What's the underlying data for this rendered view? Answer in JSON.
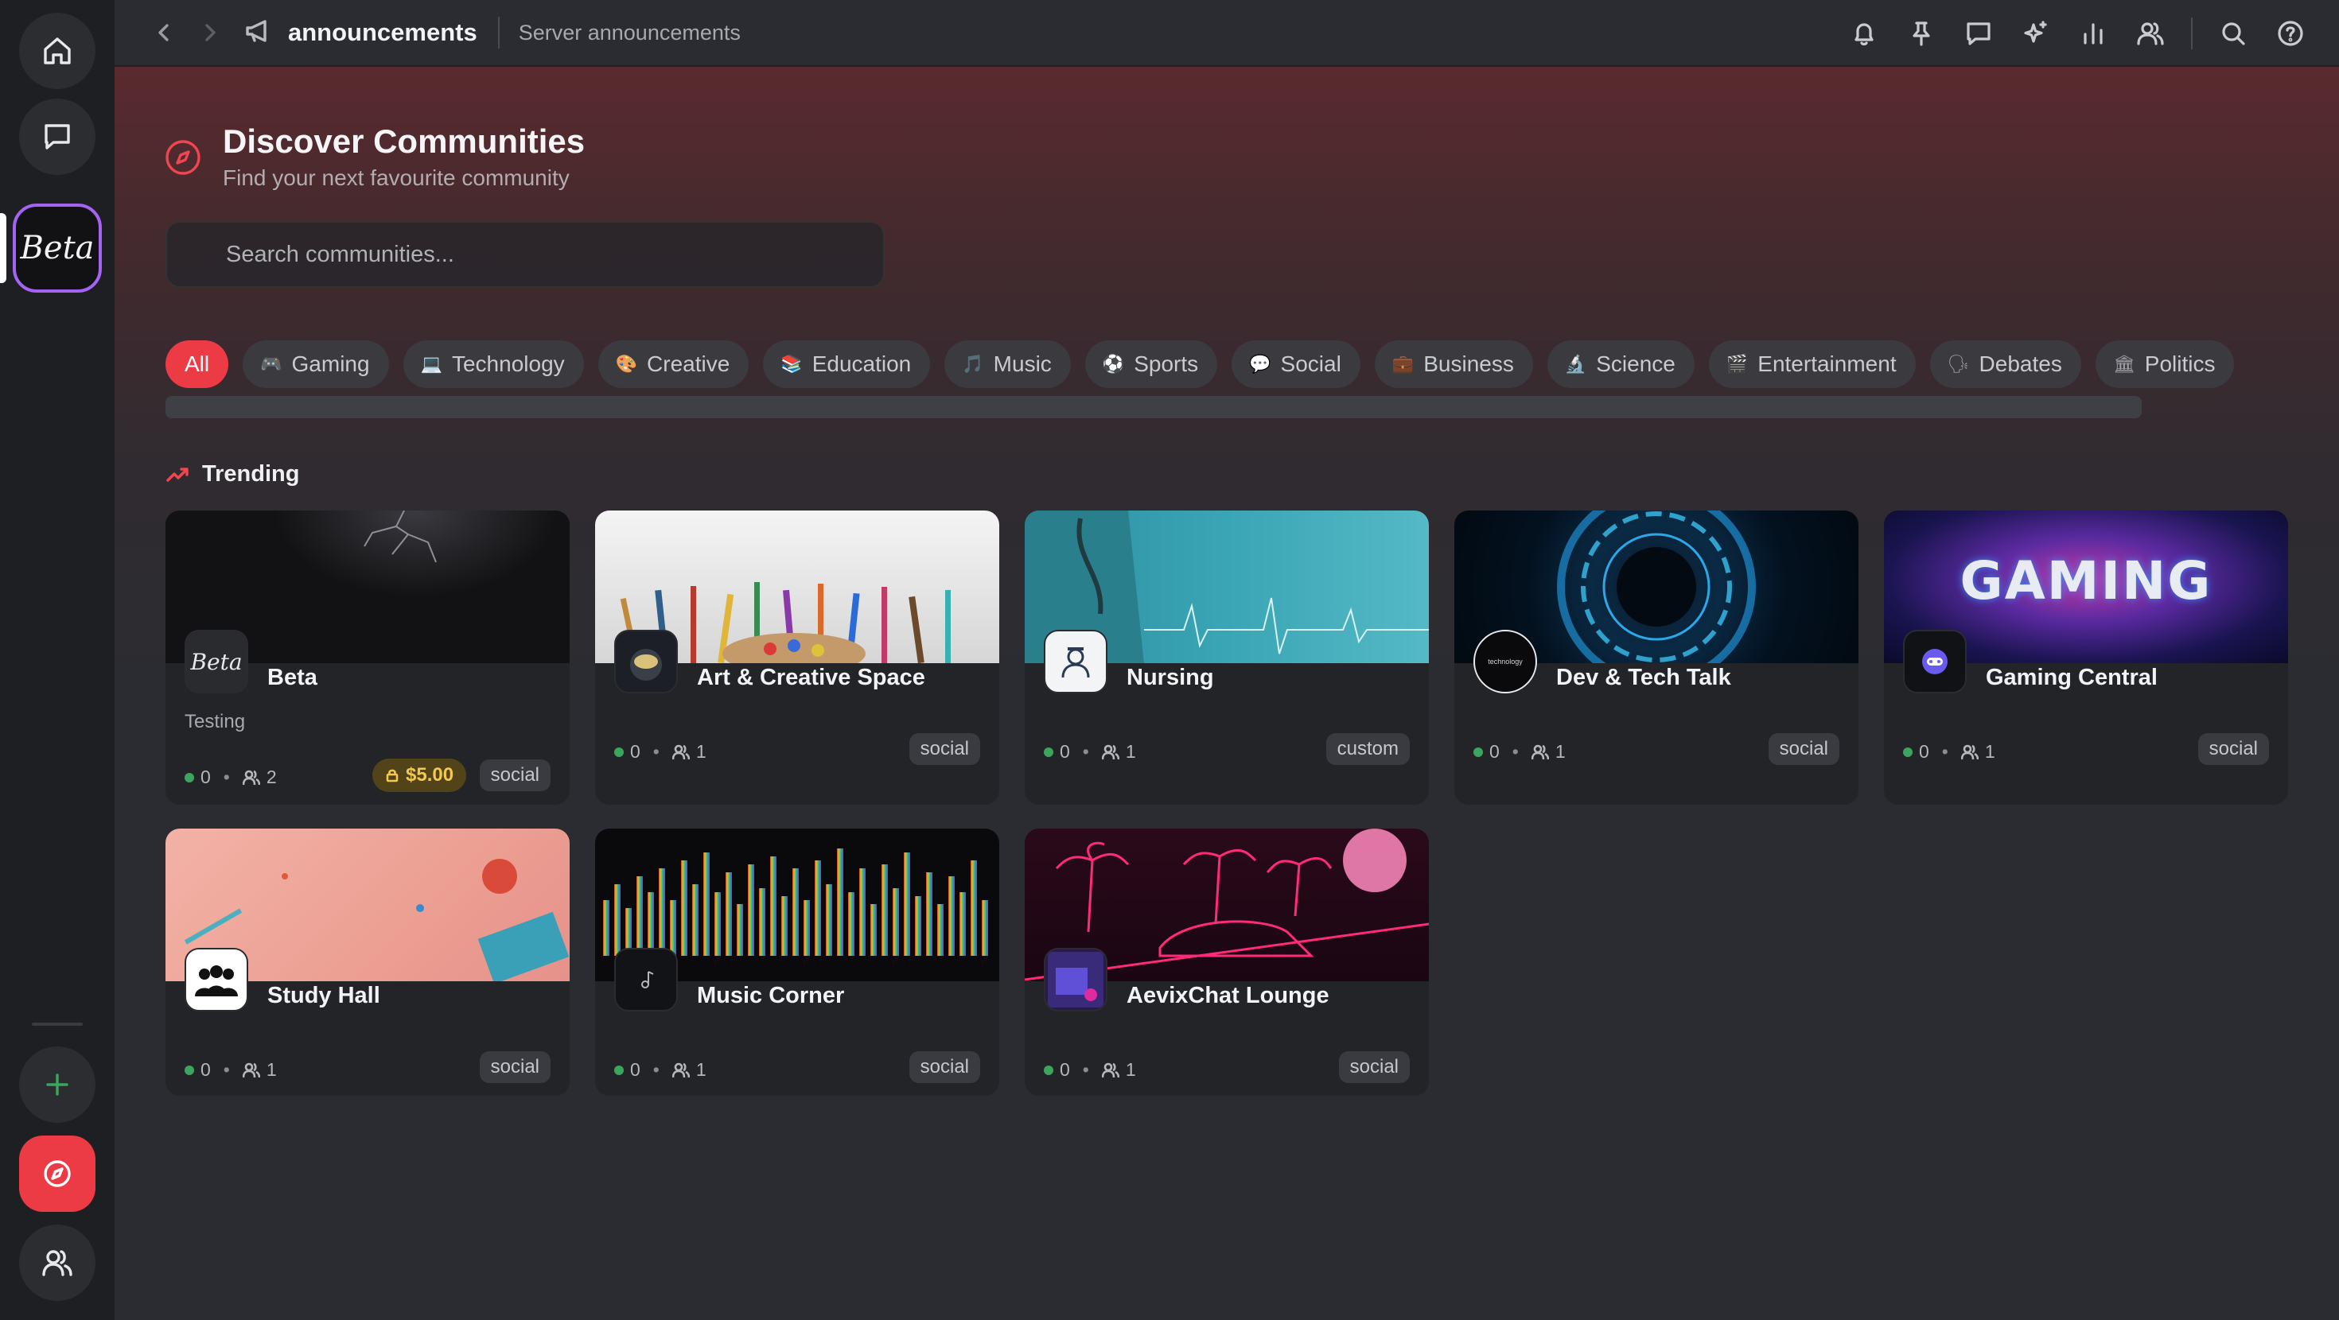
{
  "topbar": {
    "channel_name": "announcements",
    "channel_topic": "Server announcements"
  },
  "rail": {
    "server_name": "Beta"
  },
  "discover": {
    "title": "Discover Communities",
    "subtitle": "Find your next favourite community",
    "search_placeholder": "Search communities..."
  },
  "categories": [
    {
      "label": "All",
      "emoji": ""
    },
    {
      "label": "Gaming",
      "emoji": "🎮"
    },
    {
      "label": "Technology",
      "emoji": "💻"
    },
    {
      "label": "Creative",
      "emoji": "🎨"
    },
    {
      "label": "Education",
      "emoji": "📚"
    },
    {
      "label": "Music",
      "emoji": "🎵"
    },
    {
      "label": "Sports",
      "emoji": "⚽"
    },
    {
      "label": "Social",
      "emoji": "💬"
    },
    {
      "label": "Business",
      "emoji": "💼"
    },
    {
      "label": "Science",
      "emoji": "🔬"
    },
    {
      "label": "Entertainment",
      "emoji": "🎬"
    },
    {
      "label": "Debates",
      "emoji": "🗣"
    },
    {
      "label": "Politics",
      "emoji": "🏛"
    }
  ],
  "trending": {
    "title": "Trending",
    "cards": [
      {
        "name": "Beta",
        "description": "Testing",
        "online": "0",
        "members": "2",
        "price": "$5.00",
        "tag": "social",
        "avatar_text": "Beta"
      },
      {
        "name": "Art & Creative Space",
        "online": "0",
        "members": "1",
        "tag": "social"
      },
      {
        "name": "Nursing",
        "online": "0",
        "members": "1",
        "tag": "custom"
      },
      {
        "name": "Dev & Tech Talk",
        "online": "0",
        "members": "1",
        "tag": "social",
        "avatar_text": "technology"
      },
      {
        "name": "Gaming Central",
        "online": "0",
        "members": "1",
        "tag": "social",
        "banner_text": "GAMING"
      },
      {
        "name": "Study Hall",
        "online": "0",
        "members": "1",
        "tag": "social"
      },
      {
        "name": "Music Corner",
        "online": "0",
        "members": "1",
        "tag": "social"
      },
      {
        "name": "AevixChat Lounge",
        "online": "0",
        "members": "1",
        "tag": "social"
      }
    ]
  }
}
